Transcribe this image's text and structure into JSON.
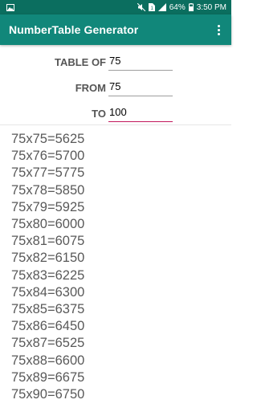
{
  "status_bar": {
    "battery_percent": "64%",
    "time": "3:50 PM",
    "icons": [
      "gallery-icon",
      "mute-icon",
      "sim-1-icon",
      "signal-icon",
      "battery-icon"
    ]
  },
  "app_bar": {
    "title": "NumberTable Generator",
    "menu_icon": "overflow-menu-icon"
  },
  "form": {
    "table_of": {
      "label": "TABLE OF",
      "value": "75"
    },
    "from": {
      "label": "FROM",
      "value": "75"
    },
    "to": {
      "label": "TO",
      "value": "100"
    }
  },
  "accent_color": "#c2185b",
  "colors": {
    "app_bar": "#11877a",
    "status_bar": "#0b6e5f"
  },
  "results": [
    "75x75=5625",
    "75x76=5700",
    "75x77=5775",
    "75x78=5850",
    "75x79=5925",
    "75x80=6000",
    "75x81=6075",
    "75x82=6150",
    "75x83=6225",
    "75x84=6300",
    "75x85=6375",
    "75x86=6450",
    "75x87=6525",
    "75x88=6600",
    "75x89=6675",
    "75x90=6750"
  ]
}
